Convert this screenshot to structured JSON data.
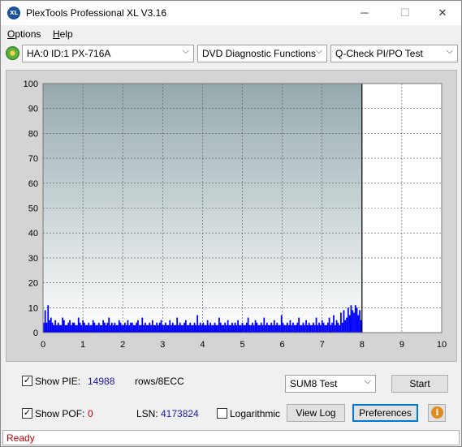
{
  "window": {
    "title": "PlexTools Professional XL V3.16",
    "icon": "XL",
    "minimize_icon": "─",
    "maximize_icon": "☐",
    "close_icon": "✕"
  },
  "menu": {
    "options_u": "O",
    "options_rest": "ptions",
    "help_u": "H",
    "help_rest": "elp"
  },
  "toolbar": {
    "drive": "HA:0 ID:1  PX-716A",
    "function": "DVD Diagnostic Functions",
    "test": "Q-Check PI/PO Test",
    "arrow": "⌵"
  },
  "chart_data": {
    "type": "bar",
    "xlim": [
      0,
      10
    ],
    "ylim": [
      0,
      100
    ],
    "x_ticks": [
      "0",
      "1",
      "2",
      "3",
      "4",
      "5",
      "6",
      "7",
      "8",
      "9",
      "10"
    ],
    "y_ticks": [
      "0",
      "10",
      "20",
      "30",
      "40",
      "50",
      "60",
      "70",
      "80",
      "90",
      "100"
    ],
    "data_end_x": 8.0,
    "grid": true,
    "series": [
      {
        "color": "#0000ff",
        "values": [
          4,
          9,
          4,
          11,
          5,
          6,
          4,
          3,
          5,
          3,
          4,
          3,
          3,
          6,
          5,
          3,
          3,
          4,
          5,
          3,
          4,
          4,
          3,
          3,
          6,
          4,
          3,
          5,
          4,
          3,
          3,
          4,
          3,
          3,
          5,
          4,
          3,
          3,
          4,
          3,
          3,
          5,
          4,
          3,
          4,
          6,
          3,
          4,
          3,
          4,
          3,
          3,
          5,
          4,
          3,
          3,
          4,
          3,
          5,
          3,
          4,
          4,
          3,
          3,
          4,
          5,
          3,
          3,
          6,
          3,
          4,
          3,
          3,
          4,
          3,
          5,
          3,
          3,
          4,
          3,
          4,
          5,
          3,
          3,
          4,
          3,
          3,
          5,
          3,
          4,
          3,
          3,
          6,
          3,
          4,
          3,
          3,
          4,
          5,
          3,
          3,
          4,
          3,
          3,
          4,
          3,
          7,
          3,
          4,
          3,
          4,
          3,
          3,
          5,
          3,
          4,
          3,
          3,
          4,
          3,
          3,
          6,
          4,
          3,
          3,
          4,
          3,
          5,
          3,
          3,
          4,
          3,
          4,
          3,
          5,
          3,
          3,
          4,
          3,
          3,
          4,
          6,
          3,
          3,
          4,
          3,
          5,
          4,
          3,
          3,
          4,
          3,
          6,
          3,
          4,
          3,
          3,
          4,
          3,
          5,
          3,
          4,
          3,
          3,
          7,
          4,
          3,
          3,
          4,
          3,
          5,
          3,
          4,
          3,
          3,
          4,
          6,
          3,
          3,
          4,
          3,
          5,
          3,
          4,
          3,
          3,
          4,
          3,
          6,
          3,
          4,
          3,
          5,
          4,
          3,
          3,
          4,
          6,
          3,
          4,
          7,
          3,
          5,
          4,
          3,
          8,
          4,
          9,
          5,
          6,
          10,
          7,
          11,
          9,
          8,
          11,
          10,
          7,
          9,
          5
        ]
      }
    ]
  },
  "controls": {
    "show_pie_label": "Show PIE:",
    "pie_value": "14988",
    "pie_unit": "rows/8ECC",
    "show_pof_label": "Show POF:",
    "pof_value": "0",
    "lsn_label": "LSN:",
    "lsn_value": "4173824",
    "logarithmic_label": "Logarithmic",
    "sum_test": "SUM8 Test",
    "start_label": "Start",
    "view_log_label": "View Log",
    "preferences_label": "Preferences",
    "check_mark": "✓",
    "info_glyph": "i"
  },
  "status": {
    "text": "Ready"
  }
}
